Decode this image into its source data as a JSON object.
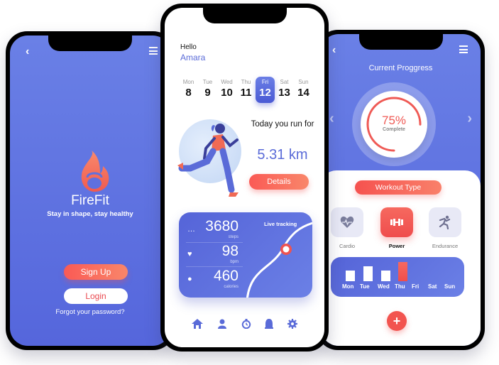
{
  "login_screen": {
    "brand": "FireFit",
    "tagline": "Stay in shape, stay healthy",
    "signup_label": "Sign Up",
    "login_label": "Login",
    "forgot_label": "Forgot your password?",
    "icons": {
      "back": "chevron-left-icon",
      "menu": "hamburger-menu-icon",
      "logo": "flame-kettlebell-icon"
    }
  },
  "home_screen": {
    "greeting": "Hello",
    "user_name": "Amara",
    "days": [
      {
        "name": "Mon",
        "date": "8"
      },
      {
        "name": "Tue",
        "date": "9"
      },
      {
        "name": "Wed",
        "date": "10"
      },
      {
        "name": "Thu",
        "date": "11"
      },
      {
        "name": "Fri",
        "date": "12",
        "selected": true
      },
      {
        "name": "Sat",
        "date": "13"
      },
      {
        "name": "Sun",
        "date": "14"
      }
    ],
    "run_text": "Today you run for",
    "distance": "5.31 km",
    "details_label": "Details",
    "stats": [
      {
        "icon": "footsteps-icon",
        "value": "3680",
        "unit": "steps"
      },
      {
        "icon": "heart-icon",
        "value": "98",
        "unit": "bpm"
      },
      {
        "icon": "flame-icon",
        "value": "460",
        "unit": "calories"
      }
    ],
    "live_tracking_label": "Live tracking",
    "nav": [
      "home-icon",
      "profile-icon",
      "stopwatch-icon",
      "bell-icon",
      "gear-icon"
    ]
  },
  "progress_screen": {
    "title": "Current Proggress",
    "percent_label": "75%",
    "percent_value": 75,
    "complete_label": "Complete",
    "workout_type_label": "Workout Type",
    "workout_types": [
      {
        "label": "Cardio",
        "icon": "heart-pulse-icon",
        "active": false
      },
      {
        "label": "Power",
        "icon": "dumbbell-icon",
        "active": true
      },
      {
        "label": "Endurance",
        "icon": "running-icon",
        "active": false
      }
    ],
    "week": [
      {
        "day": "Mon",
        "level": 0.5
      },
      {
        "day": "Tue",
        "level": 0.7
      },
      {
        "day": "Wed",
        "level": 0.5
      },
      {
        "day": "Thu",
        "level": 0.9,
        "highlight": true
      },
      {
        "day": "Fri",
        "level": 0
      },
      {
        "day": "Sat",
        "level": 0
      },
      {
        "day": "Sun",
        "level": 0
      }
    ],
    "colors": {
      "accent": "#f2544f",
      "primary": "#5a6bd8"
    }
  }
}
